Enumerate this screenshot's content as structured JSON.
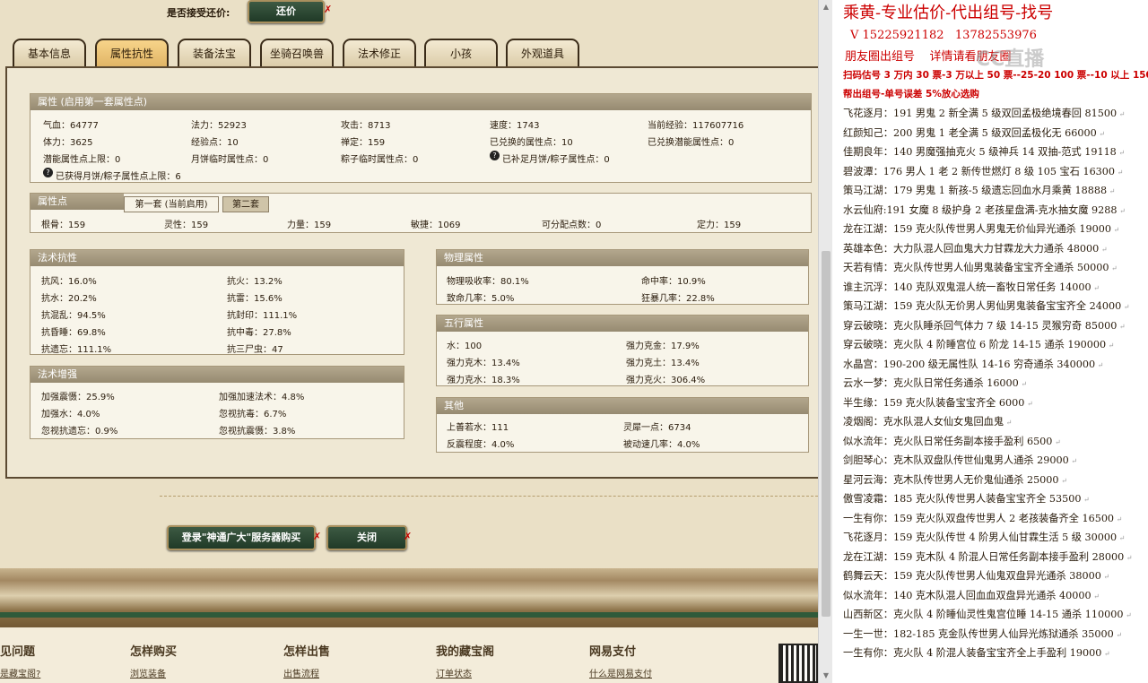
{
  "header": {
    "accept_label": "是否接受还价:",
    "haggle_button": "还价"
  },
  "tabs": [
    "基本信息",
    "属性抗性",
    "装备法宝",
    "坐骑召唤兽",
    "法术修正",
    "小孩",
    "外观道具"
  ],
  "attr_panel": {
    "title": "属性 (启用第一套属性点)",
    "rows": [
      [
        "气血：64777",
        "法力：52923",
        "攻击：8713",
        "速度：1743",
        "当前经验：117607716"
      ],
      [
        "体力：3625",
        "经验点：10",
        "禅定：159",
        "已兑换的属性点：10",
        "已兑换潜能属性点：0"
      ],
      [
        "潜能属性点上限：0",
        "月饼临时属性点：0",
        "粽子临时属性点：0",
        "已补足月饼/粽子属性点：0",
        ""
      ],
      [
        "已获得月饼/粽子属性点上限：6",
        "",
        "",
        "",
        ""
      ]
    ]
  },
  "points_panel": {
    "title": "属性点",
    "tab1": "第一套 (当前启用)",
    "tab2": "第二套",
    "values": [
      "根骨：159",
      "灵性：159",
      "力量：159",
      "敏捷：1069",
      "可分配点数：0",
      "定力：159"
    ]
  },
  "spell_resist": {
    "title": "法术抗性",
    "rows": [
      [
        "抗风：16.0%",
        "抗火：13.2%"
      ],
      [
        "抗水：20.2%",
        "抗雷：15.6%"
      ],
      [
        "抗混乱：94.5%",
        "抗封印：111.1%"
      ],
      [
        "抗昏睡：69.8%",
        "抗中毒：27.8%"
      ],
      [
        "抗遗忘：111.1%",
        "抗三尸虫：47"
      ]
    ]
  },
  "spell_enhance": {
    "title": "法术增强",
    "rows": [
      [
        "加强震慑：25.9%",
        "加强加速法术：4.8%"
      ],
      [
        "加强水：4.0%",
        "忽视抗毒：6.7%"
      ],
      [
        "忽视抗遗忘：0.9%",
        "忽视抗震慑：3.8%"
      ]
    ]
  },
  "physical": {
    "title": "物理属性",
    "rows": [
      [
        "物理吸收率：80.1%",
        "命中率：10.9%"
      ],
      [
        "致命几率：5.0%",
        "狂暴几率：22.8%"
      ]
    ]
  },
  "five_elements": {
    "title": "五行属性",
    "rows": [
      [
        "水：100",
        "强力克金：17.9%"
      ],
      [
        "强力克木：13.4%",
        "强力克土：13.4%"
      ],
      [
        "强力克水：18.3%",
        "强力克火：306.4%"
      ]
    ]
  },
  "other": {
    "title": "其他",
    "rows": [
      [
        "上善若水：111",
        "灵犀一点：6734"
      ],
      [
        "反震程度：4.0%",
        "被动速几率：4.0%"
      ]
    ]
  },
  "actions": {
    "login_buy": "登录\"神通广大\"服务器购买",
    "close": "关闭"
  },
  "footer": {
    "cols": [
      {
        "h": "见问题",
        "l": "是藏宝阁?"
      },
      {
        "h": "怎样购买",
        "l": "浏览装备"
      },
      {
        "h": "怎样出售",
        "l": "出售流程"
      },
      {
        "h": "我的藏宝阁",
        "l": "订单状态"
      },
      {
        "h": "网易支付",
        "l": "什么是网易支付"
      }
    ]
  },
  "right_panel": {
    "title": "乘黄-专业估价-代出组号-找号",
    "contact": "V 15225921182   13782553976",
    "note": "朋友圈出组号    详情请看朋友圈",
    "promo1": "扫码估号 3 万内 30 票-3 万以上 50 票--25-20 100 票--10 以上 150",
    "promo2": "帮出组号-单号误差 5%放心选购",
    "watermark": "CC直播",
    "listings": [
      [
        "飞花逐月：",
        "191 男鬼 2 新全满 5 级双回孟极绝境春回 81500"
      ],
      [
        "红颜知己：",
        "200 男鬼 1 老全满 5 级双回孟极化无 66000"
      ],
      [
        "佳期良年：",
        "140 男魔强抽克火 5 级神兵 14 双抽-范式 19118"
      ],
      [
        "碧波潭：",
        "176 男人 1 老 2 新传世燃灯 8 级 105 宝石 16300"
      ],
      [
        "策马江湖：",
        "179 男鬼 1 新孩-5 级遗忘回血水月乘黄 18888"
      ],
      [
        "水云仙府:",
        "191 女魔 8 级护身 2 老孩星盘满-克水抽女魔 9288"
      ],
      [
        "龙在江湖：",
        "159 克火队传世男人男鬼无价仙异光通杀 19000"
      ],
      [
        "英雄本色：",
        "大力队混人回血鬼大力甘霖龙大力通杀 48000"
      ],
      [
        "天若有情：",
        "克火队传世男人仙男鬼装备宝宝齐全通杀 50000"
      ],
      [
        "谁主沉浮：",
        "140 克队双鬼混人统一畜牧日常任务 14000"
      ],
      [
        "策马江湖：",
        "159 克火队无价男人男仙男鬼装备宝宝齐全 24000"
      ],
      [
        "穿云破晓：",
        "克火队睡杀回气体力 7 级 14-15 灵猴穷奇 85000"
      ],
      [
        "穿云破晓：",
        "克火队 4 阶睡宫位 6 阶龙 14-15 通杀 190000"
      ],
      [
        "水晶宫：",
        "190-200 级无属性队 14-16 穷奇通杀 340000"
      ],
      [
        "云水一梦：",
        "克火队日常任务通杀 16000"
      ],
      [
        "半生缘：",
        "159 克火队装备宝宝齐全 6000"
      ],
      [
        "凌烟阁：",
        "克水队混人女仙女鬼回血鬼"
      ],
      [
        "似水流年：",
        "克火队日常任务副本接手盈利 6500"
      ],
      [
        "剑胆琴心：",
        "克木队双盘队传世仙鬼男人通杀 29000"
      ],
      [
        "星河云海：",
        "克木队传世男人无价鬼仙通杀 25000"
      ],
      [
        "傲雪凌霜：",
        "185 克火队传世男人装备宝宝齐全 53500"
      ],
      [
        "一生有你：",
        "159 克火队双盘传世男人 2 老孩装备齐全 16500"
      ],
      [
        "飞花逐月：",
        "159 克火队传世 4 阶男人仙甘霖生活 5 级 30000"
      ],
      [
        "龙在江湖：",
        "159 克木队 4 阶混人日常任务副本接手盈利 28000"
      ],
      [
        "鹤舞云天：",
        "159 克火队传世男人仙鬼双盘异光通杀 38000"
      ],
      [
        "似水流年：",
        "140 克木队混人回血血双盘异光通杀 40000"
      ],
      [
        "山西新区：",
        "克火队 4 阶睡仙灵性鬼宫位睡 14-15 通杀 110000"
      ],
      [
        "一生一世：",
        "182-185 克金队传世男人仙异光炼狱通杀 35000"
      ],
      [
        "一生有你：",
        "克火队 4 阶混人装备宝宝齐全上手盈利 19000"
      ]
    ]
  },
  "colors": {
    "panel_head": "#9f937a",
    "tab_active": "#eec57a",
    "red_text": "#cc0000",
    "button_green": "#2c4a33"
  }
}
